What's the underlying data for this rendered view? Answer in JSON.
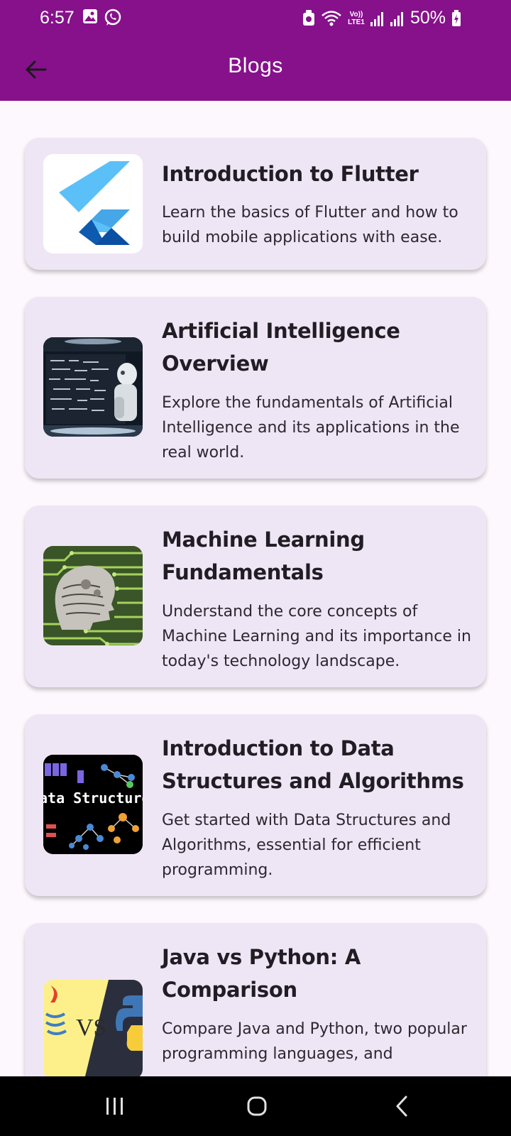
{
  "status_bar": {
    "time": "6:57",
    "battery": "50%",
    "left_icons": [
      "image-icon",
      "whatsapp-icon"
    ],
    "right_icons": [
      "alarm-icon",
      "wifi-icon",
      "volte-icon",
      "signal-icon",
      "signal-icon",
      "battery-icon"
    ],
    "volte_label": "Vo)) LTE1"
  },
  "app_bar": {
    "title": "Blogs",
    "back_icon": "arrow-left-icon",
    "color": "#86118b"
  },
  "blogs": [
    {
      "title": "Introduction to Flutter",
      "description": "Learn the basics of Flutter and how to build mobile applications with ease.",
      "thumbnail": "flutter-logo"
    },
    {
      "title": "Artificial Intelligence Overview",
      "description": "Explore the fundamentals of Artificial Intelligence and its applications in the real world.",
      "thumbnail": "ai-robot-image"
    },
    {
      "title": "Machine Learning Fundamentals",
      "description": "Understand the core concepts of Machine Learning and its importance in today's technology landscape.",
      "thumbnail": "ml-circuit-head-image"
    },
    {
      "title": "Introduction to Data Structures and Algorithms",
      "description": "Get started with Data Structures and Algorithms, essential for efficient programming.",
      "thumbnail": "data-structures-image",
      "thumb_text": "ata Structure"
    },
    {
      "title": "Java vs Python: A Comparison",
      "description": "Compare Java and Python, two popular programming languages, and",
      "thumbnail": "java-vs-python-image",
      "thumb_text": "VS"
    }
  ],
  "nav_bar": {
    "buttons": [
      "recent-apps-icon",
      "home-icon",
      "back-icon"
    ]
  },
  "colors": {
    "primary": "#86118b",
    "card_bg": "#efe6f5",
    "page_bg": "#fdf8fd"
  }
}
